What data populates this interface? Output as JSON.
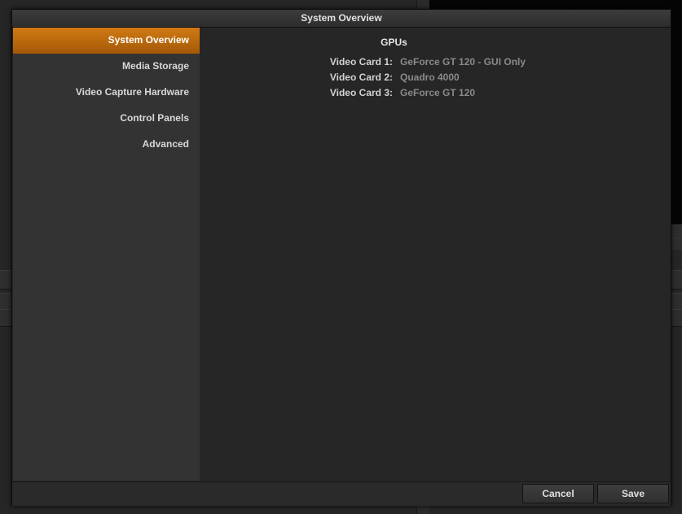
{
  "dialog": {
    "title": "System Overview"
  },
  "sidebar": {
    "items": [
      {
        "label": "System Overview",
        "active": true
      },
      {
        "label": "Media Storage",
        "active": false
      },
      {
        "label": "Video Capture Hardware",
        "active": false
      },
      {
        "label": "Control Panels",
        "active": false
      },
      {
        "label": "Advanced",
        "active": false
      }
    ]
  },
  "main": {
    "section_title": "GPUs",
    "gpus": [
      {
        "label": "Video Card 1:",
        "value": "GeForce GT 120 - GUI Only"
      },
      {
        "label": "Video Card 2:",
        "value": "Quadro 4000"
      },
      {
        "label": "Video Card 3:",
        "value": "GeForce GT 120"
      }
    ]
  },
  "footer": {
    "cancel_label": "Cancel",
    "save_label": "Save"
  },
  "colors": {
    "accent": "#c06c0e",
    "sidebar_bg": "#333333",
    "content_bg": "#262626"
  }
}
